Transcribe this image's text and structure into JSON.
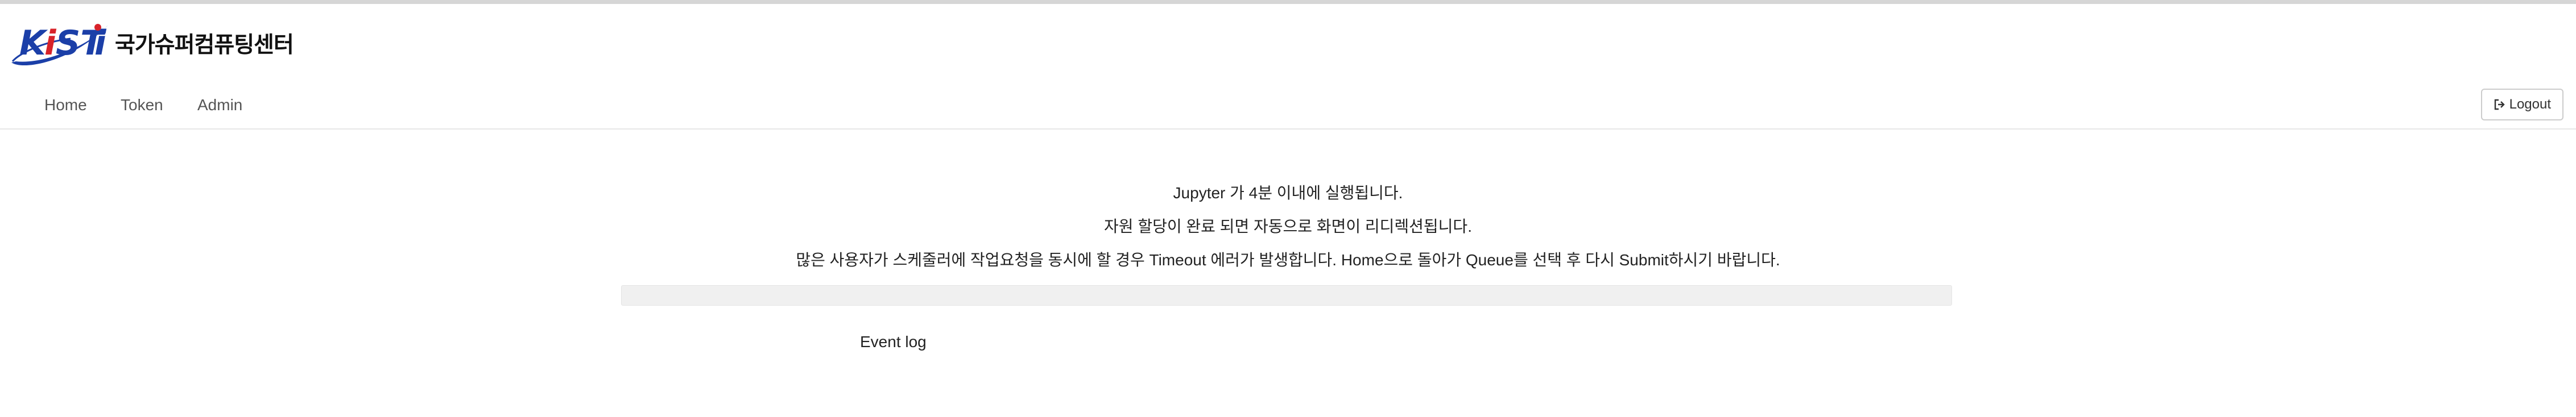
{
  "header": {
    "logo_text": "KiSTi",
    "org_name": "국가슈퍼컴퓨팅센터",
    "brand_colors": {
      "primary": "#1b3fa8",
      "accent": "#d8232a"
    }
  },
  "nav": {
    "items": [
      {
        "label": "Home"
      },
      {
        "label": "Token"
      },
      {
        "label": "Admin"
      }
    ],
    "logout_label": "Logout",
    "logout_icon": "sign-out-icon"
  },
  "main": {
    "messages": [
      "Jupyter 가 4분 이내에 실행됩니다.",
      "자원 할당이 완료 되면 자동으로 화면이 리디렉션됩니다.",
      "많은 사용자가 스케줄러에 작업요청을 동시에 할 경우 Timeout 에러가 발생합니다. Home으로 돌아가 Queue를 선택 후 다시 Submit하시기 바랍니다."
    ],
    "progress_fraction": 0,
    "event_log_label": "Event log"
  }
}
